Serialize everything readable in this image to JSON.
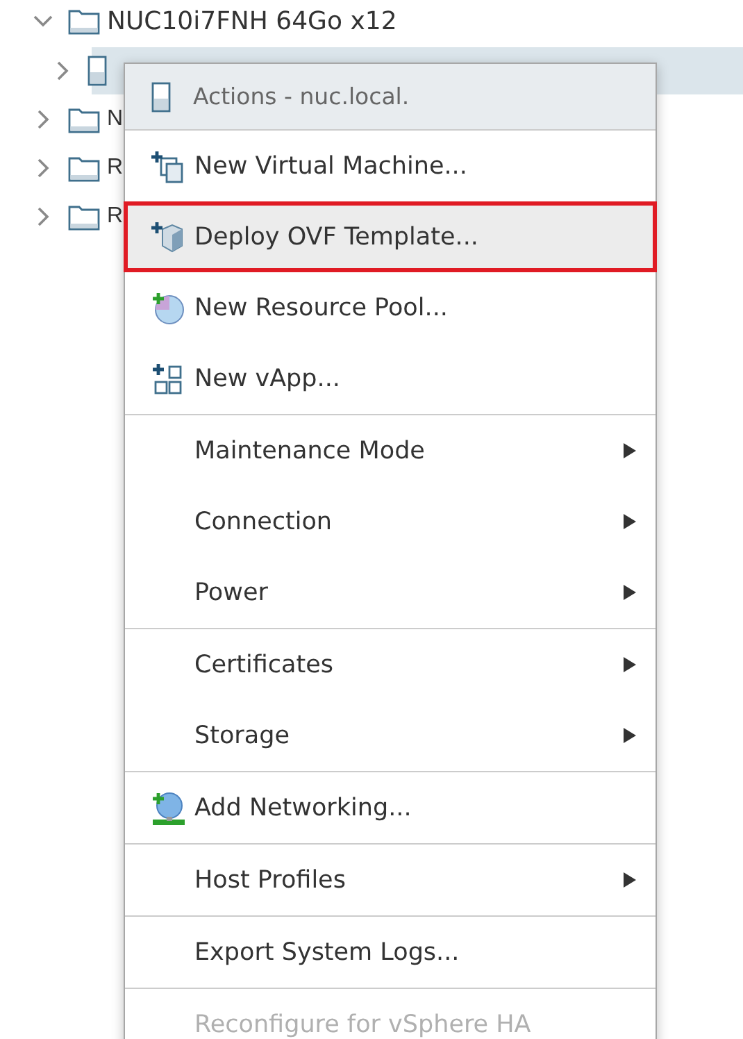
{
  "tree": [
    {
      "label": "NUC10i7FNH 64Go x12",
      "kind": "folder",
      "expanded": true,
      "selected": false,
      "children": [
        {
          "kind": "host",
          "expanded": false,
          "selected": true
        }
      ]
    },
    {
      "label": "N",
      "kind": "folder",
      "expanded": false,
      "selected": false
    },
    {
      "label": "R",
      "kind": "folder",
      "expanded": false,
      "selected": false
    },
    {
      "label": "R",
      "kind": "folder",
      "expanded": false,
      "selected": false
    }
  ],
  "context_menu": {
    "title": "Actions - nuc.local.",
    "sections": [
      [
        {
          "label": "New Virtual Machine...",
          "kind": "vm",
          "submenu": false,
          "disabled": false,
          "selected": false
        },
        {
          "label": "Deploy OVF Template...",
          "kind": "ovf",
          "submenu": false,
          "disabled": false,
          "selected": true
        },
        {
          "label": "New Resource Pool...",
          "kind": "pool",
          "submenu": false,
          "disabled": false,
          "selected": false
        },
        {
          "label": "New vApp...",
          "kind": "vapp",
          "submenu": false,
          "disabled": false,
          "selected": false
        }
      ],
      [
        {
          "label": "Maintenance Mode",
          "kind": "plain",
          "submenu": true,
          "disabled": false,
          "selected": false
        },
        {
          "label": "Connection",
          "kind": "plain",
          "submenu": true,
          "disabled": false,
          "selected": false
        },
        {
          "label": "Power",
          "kind": "plain",
          "submenu": true,
          "disabled": false,
          "selected": false
        }
      ],
      [
        {
          "label": "Certificates",
          "kind": "plain",
          "submenu": true,
          "disabled": false,
          "selected": false
        },
        {
          "label": "Storage",
          "kind": "plain",
          "submenu": true,
          "disabled": false,
          "selected": false
        }
      ],
      [
        {
          "label": "Add Networking...",
          "kind": "network",
          "submenu": false,
          "disabled": false,
          "selected": false
        }
      ],
      [
        {
          "label": "Host Profiles",
          "kind": "plain",
          "submenu": true,
          "disabled": false,
          "selected": false
        }
      ],
      [
        {
          "label": "Export System Logs...",
          "kind": "plain",
          "submenu": false,
          "disabled": false,
          "selected": false
        }
      ],
      [
        {
          "label": "Reconfigure for vSphere HA",
          "kind": "plain",
          "submenu": false,
          "disabled": true,
          "selected": false
        }
      ]
    ]
  }
}
